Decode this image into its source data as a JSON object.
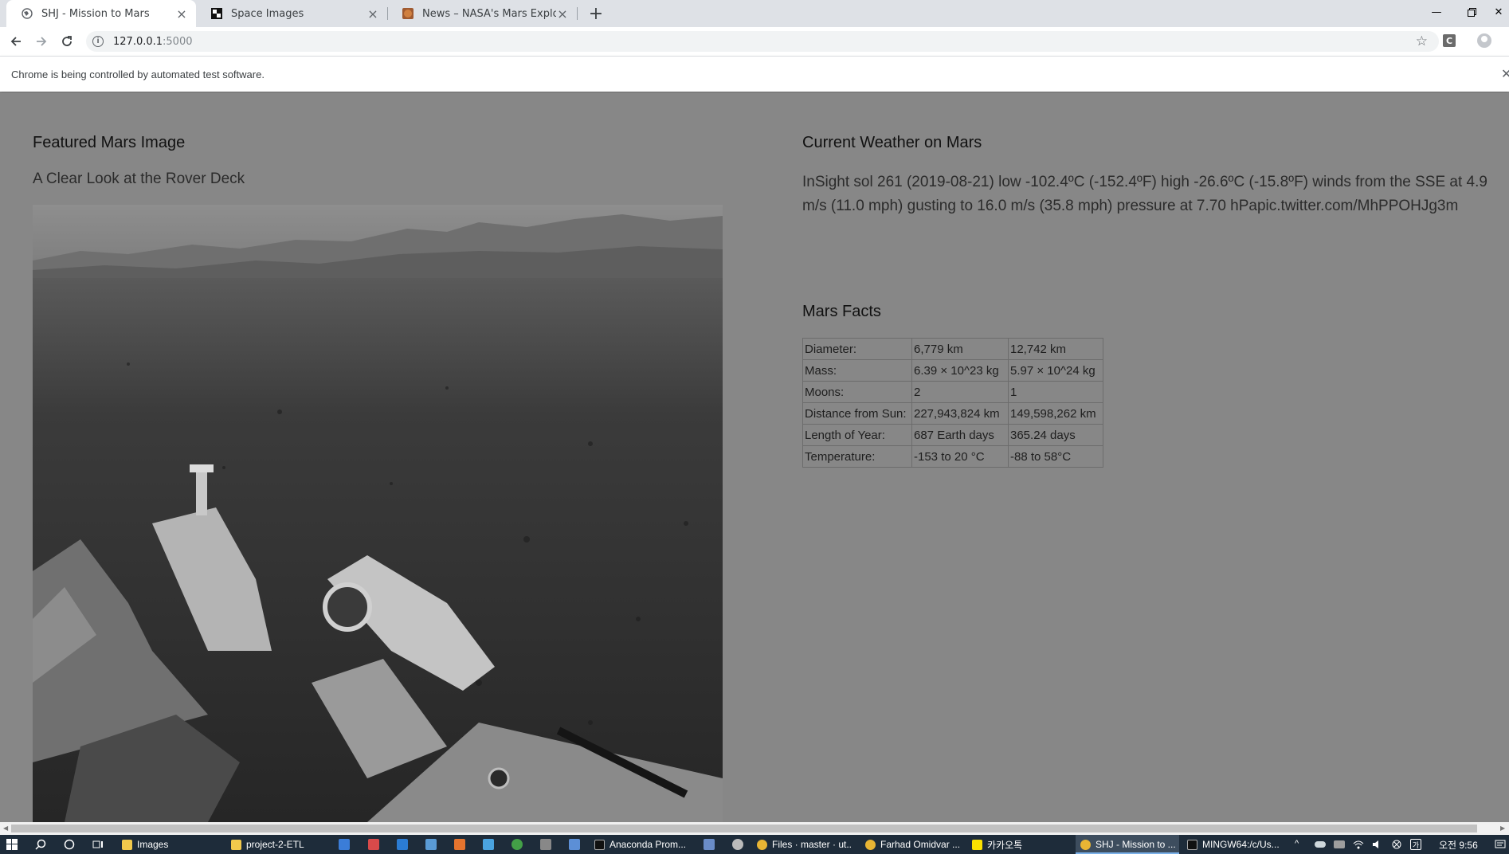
{
  "browser": {
    "tabs": [
      {
        "title": "SHJ - Mission to Mars",
        "active": true
      },
      {
        "title": "Space Images",
        "active": false
      },
      {
        "title": "News – NASA's Mars Exploration",
        "active": false
      }
    ],
    "url_host": "127.0.0.1",
    "url_port": ":5000",
    "infobar_message": "Chrome is being controlled by automated test software.",
    "extension_label": "C"
  },
  "page": {
    "featured_heading": "Featured Mars Image",
    "featured_title": "A Clear Look at the Rover Deck",
    "weather_heading": "Current Weather on Mars",
    "weather_text": "InSight sol 261 (2019-08-21) low -102.4ºC (-152.4ºF) high -26.6ºC (-15.8ºF) winds from the SSE at 4.9 m/s (11.0 mph) gusting to 16.0 m/s (35.8 mph) pressure at 7.70 hPapic.twitter.com/MhPPOHJg3m",
    "facts_heading": "Mars Facts",
    "facts": [
      [
        "Diameter:",
        "6,779 km",
        "12,742 km"
      ],
      [
        "Mass:",
        "6.39 × 10^23 kg",
        "5.97 × 10^24 kg"
      ],
      [
        "Moons:",
        "2",
        "1"
      ],
      [
        "Distance from Sun:",
        "227,943,824 km",
        "149,598,262 km"
      ],
      [
        "Length of Year:",
        "687 Earth days",
        "365.24 days"
      ],
      [
        "Temperature:",
        "-153 to 20 °C",
        "-88 to 58°C"
      ]
    ]
  },
  "taskbar": {
    "items": [
      "Images",
      "project-2-ETL",
      "Anaconda Prom...",
      "Files · master · ut...",
      "Farhad Omidvar ...",
      "카카오톡",
      "SHJ - Mission to ...",
      "MINGW64:/c/Us..."
    ],
    "clock": "오전 9:56"
  }
}
